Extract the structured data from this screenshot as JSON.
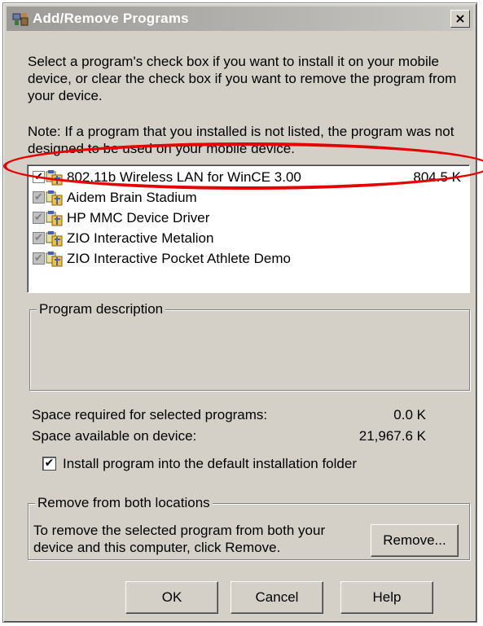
{
  "window": {
    "title": "Add/Remove Programs",
    "close_glyph": "×",
    "title_icon": "add-remove-programs-icon"
  },
  "intro_text": "Select a program's check box if you want to install it on your mobile device, or clear the check box if you want to remove the program from your device.",
  "note_text": "Note:  If a program that you installed is not listed, the program was not designed to be used on your mobile device.",
  "programs": [
    {
      "name": "802.11b Wireless LAN for WinCE 3.00",
      "size": "804.5 K",
      "checked": true,
      "enabled": true,
      "icon": "package-icon"
    },
    {
      "name": "Aidem Brain Stadium",
      "size": "",
      "checked": true,
      "enabled": false,
      "icon": "package-icon"
    },
    {
      "name": "HP MMC Device Driver",
      "size": "",
      "checked": true,
      "enabled": false,
      "icon": "package-icon"
    },
    {
      "name": "ZIO Interactive Metalion",
      "size": "",
      "checked": true,
      "enabled": false,
      "icon": "package-icon"
    },
    {
      "name": "ZIO Interactive Pocket Athlete Demo",
      "size": "",
      "checked": true,
      "enabled": false,
      "icon": "package-icon"
    }
  ],
  "check_glyph": "✔",
  "description_group": {
    "legend": "Program description",
    "text": ""
  },
  "space": {
    "required_label": "Space required for selected programs:",
    "required_value": "0.0 K",
    "available_label": "Space available on device:",
    "available_value": "21,967.6 K"
  },
  "default_folder": {
    "label": "Install program into the default installation folder",
    "checked": true
  },
  "remove_group": {
    "legend": "Remove from both locations",
    "text": "To remove the selected program from both your device and this computer, click Remove.",
    "button_label": "Remove..."
  },
  "buttons": {
    "ok": "OK",
    "cancel": "Cancel",
    "help": "Help"
  },
  "annotation": {
    "color": "#e60000",
    "shape": "ellipse"
  }
}
